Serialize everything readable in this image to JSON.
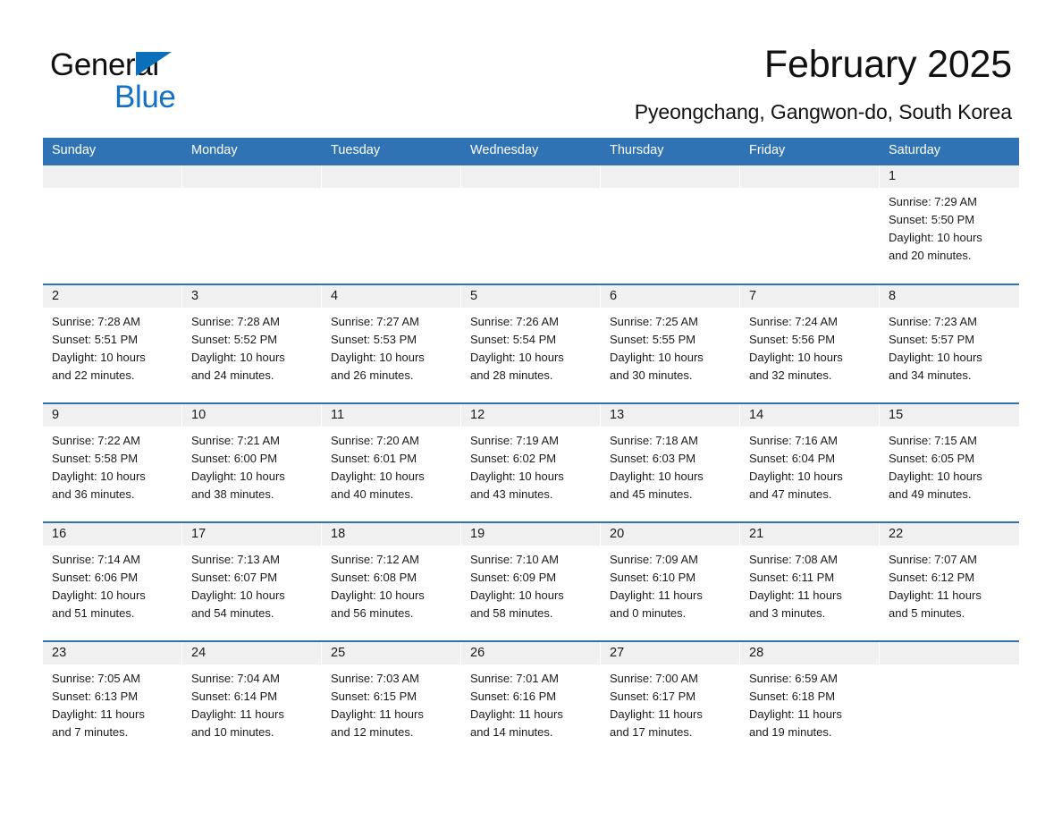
{
  "brand": {
    "line1": "General",
    "line2": "Blue",
    "triangle_color": "#0b6fbb",
    "blue_text_color": "#1271c4"
  },
  "header": {
    "title": "February 2025",
    "subtitle": "Pyeongchang, Gangwon-do, South Korea",
    "accent_color": "#3073b4",
    "daynum_band_color": "#f0f0f0"
  },
  "weekday_headers": [
    "Sunday",
    "Monday",
    "Tuesday",
    "Wednesday",
    "Thursday",
    "Friday",
    "Saturday"
  ],
  "weeks": [
    [
      {
        "day": "",
        "sunrise": "",
        "sunset": "",
        "daylight1": "",
        "daylight2": ""
      },
      {
        "day": "",
        "sunrise": "",
        "sunset": "",
        "daylight1": "",
        "daylight2": ""
      },
      {
        "day": "",
        "sunrise": "",
        "sunset": "",
        "daylight1": "",
        "daylight2": ""
      },
      {
        "day": "",
        "sunrise": "",
        "sunset": "",
        "daylight1": "",
        "daylight2": ""
      },
      {
        "day": "",
        "sunrise": "",
        "sunset": "",
        "daylight1": "",
        "daylight2": ""
      },
      {
        "day": "",
        "sunrise": "",
        "sunset": "",
        "daylight1": "",
        "daylight2": ""
      },
      {
        "day": "1",
        "sunrise": "Sunrise: 7:29 AM",
        "sunset": "Sunset: 5:50 PM",
        "daylight1": "Daylight: 10 hours",
        "daylight2": "and 20 minutes."
      }
    ],
    [
      {
        "day": "2",
        "sunrise": "Sunrise: 7:28 AM",
        "sunset": "Sunset: 5:51 PM",
        "daylight1": "Daylight: 10 hours",
        "daylight2": "and 22 minutes."
      },
      {
        "day": "3",
        "sunrise": "Sunrise: 7:28 AM",
        "sunset": "Sunset: 5:52 PM",
        "daylight1": "Daylight: 10 hours",
        "daylight2": "and 24 minutes."
      },
      {
        "day": "4",
        "sunrise": "Sunrise: 7:27 AM",
        "sunset": "Sunset: 5:53 PM",
        "daylight1": "Daylight: 10 hours",
        "daylight2": "and 26 minutes."
      },
      {
        "day": "5",
        "sunrise": "Sunrise: 7:26 AM",
        "sunset": "Sunset: 5:54 PM",
        "daylight1": "Daylight: 10 hours",
        "daylight2": "and 28 minutes."
      },
      {
        "day": "6",
        "sunrise": "Sunrise: 7:25 AM",
        "sunset": "Sunset: 5:55 PM",
        "daylight1": "Daylight: 10 hours",
        "daylight2": "and 30 minutes."
      },
      {
        "day": "7",
        "sunrise": "Sunrise: 7:24 AM",
        "sunset": "Sunset: 5:56 PM",
        "daylight1": "Daylight: 10 hours",
        "daylight2": "and 32 minutes."
      },
      {
        "day": "8",
        "sunrise": "Sunrise: 7:23 AM",
        "sunset": "Sunset: 5:57 PM",
        "daylight1": "Daylight: 10 hours",
        "daylight2": "and 34 minutes."
      }
    ],
    [
      {
        "day": "9",
        "sunrise": "Sunrise: 7:22 AM",
        "sunset": "Sunset: 5:58 PM",
        "daylight1": "Daylight: 10 hours",
        "daylight2": "and 36 minutes."
      },
      {
        "day": "10",
        "sunrise": "Sunrise: 7:21 AM",
        "sunset": "Sunset: 6:00 PM",
        "daylight1": "Daylight: 10 hours",
        "daylight2": "and 38 minutes."
      },
      {
        "day": "11",
        "sunrise": "Sunrise: 7:20 AM",
        "sunset": "Sunset: 6:01 PM",
        "daylight1": "Daylight: 10 hours",
        "daylight2": "and 40 minutes."
      },
      {
        "day": "12",
        "sunrise": "Sunrise: 7:19 AM",
        "sunset": "Sunset: 6:02 PM",
        "daylight1": "Daylight: 10 hours",
        "daylight2": "and 43 minutes."
      },
      {
        "day": "13",
        "sunrise": "Sunrise: 7:18 AM",
        "sunset": "Sunset: 6:03 PM",
        "daylight1": "Daylight: 10 hours",
        "daylight2": "and 45 minutes."
      },
      {
        "day": "14",
        "sunrise": "Sunrise: 7:16 AM",
        "sunset": "Sunset: 6:04 PM",
        "daylight1": "Daylight: 10 hours",
        "daylight2": "and 47 minutes."
      },
      {
        "day": "15",
        "sunrise": "Sunrise: 7:15 AM",
        "sunset": "Sunset: 6:05 PM",
        "daylight1": "Daylight: 10 hours",
        "daylight2": "and 49 minutes."
      }
    ],
    [
      {
        "day": "16",
        "sunrise": "Sunrise: 7:14 AM",
        "sunset": "Sunset: 6:06 PM",
        "daylight1": "Daylight: 10 hours",
        "daylight2": "and 51 minutes."
      },
      {
        "day": "17",
        "sunrise": "Sunrise: 7:13 AM",
        "sunset": "Sunset: 6:07 PM",
        "daylight1": "Daylight: 10 hours",
        "daylight2": "and 54 minutes."
      },
      {
        "day": "18",
        "sunrise": "Sunrise: 7:12 AM",
        "sunset": "Sunset: 6:08 PM",
        "daylight1": "Daylight: 10 hours",
        "daylight2": "and 56 minutes."
      },
      {
        "day": "19",
        "sunrise": "Sunrise: 7:10 AM",
        "sunset": "Sunset: 6:09 PM",
        "daylight1": "Daylight: 10 hours",
        "daylight2": "and 58 minutes."
      },
      {
        "day": "20",
        "sunrise": "Sunrise: 7:09 AM",
        "sunset": "Sunset: 6:10 PM",
        "daylight1": "Daylight: 11 hours",
        "daylight2": "and 0 minutes."
      },
      {
        "day": "21",
        "sunrise": "Sunrise: 7:08 AM",
        "sunset": "Sunset: 6:11 PM",
        "daylight1": "Daylight: 11 hours",
        "daylight2": "and 3 minutes."
      },
      {
        "day": "22",
        "sunrise": "Sunrise: 7:07 AM",
        "sunset": "Sunset: 6:12 PM",
        "daylight1": "Daylight: 11 hours",
        "daylight2": "and 5 minutes."
      }
    ],
    [
      {
        "day": "23",
        "sunrise": "Sunrise: 7:05 AM",
        "sunset": "Sunset: 6:13 PM",
        "daylight1": "Daylight: 11 hours",
        "daylight2": "and 7 minutes."
      },
      {
        "day": "24",
        "sunrise": "Sunrise: 7:04 AM",
        "sunset": "Sunset: 6:14 PM",
        "daylight1": "Daylight: 11 hours",
        "daylight2": "and 10 minutes."
      },
      {
        "day": "25",
        "sunrise": "Sunrise: 7:03 AM",
        "sunset": "Sunset: 6:15 PM",
        "daylight1": "Daylight: 11 hours",
        "daylight2": "and 12 minutes."
      },
      {
        "day": "26",
        "sunrise": "Sunrise: 7:01 AM",
        "sunset": "Sunset: 6:16 PM",
        "daylight1": "Daylight: 11 hours",
        "daylight2": "and 14 minutes."
      },
      {
        "day": "27",
        "sunrise": "Sunrise: 7:00 AM",
        "sunset": "Sunset: 6:17 PM",
        "daylight1": "Daylight: 11 hours",
        "daylight2": "and 17 minutes."
      },
      {
        "day": "28",
        "sunrise": "Sunrise: 6:59 AM",
        "sunset": "Sunset: 6:18 PM",
        "daylight1": "Daylight: 11 hours",
        "daylight2": "and 19 minutes."
      },
      {
        "day": "",
        "sunrise": "",
        "sunset": "",
        "daylight1": "",
        "daylight2": ""
      }
    ]
  ]
}
